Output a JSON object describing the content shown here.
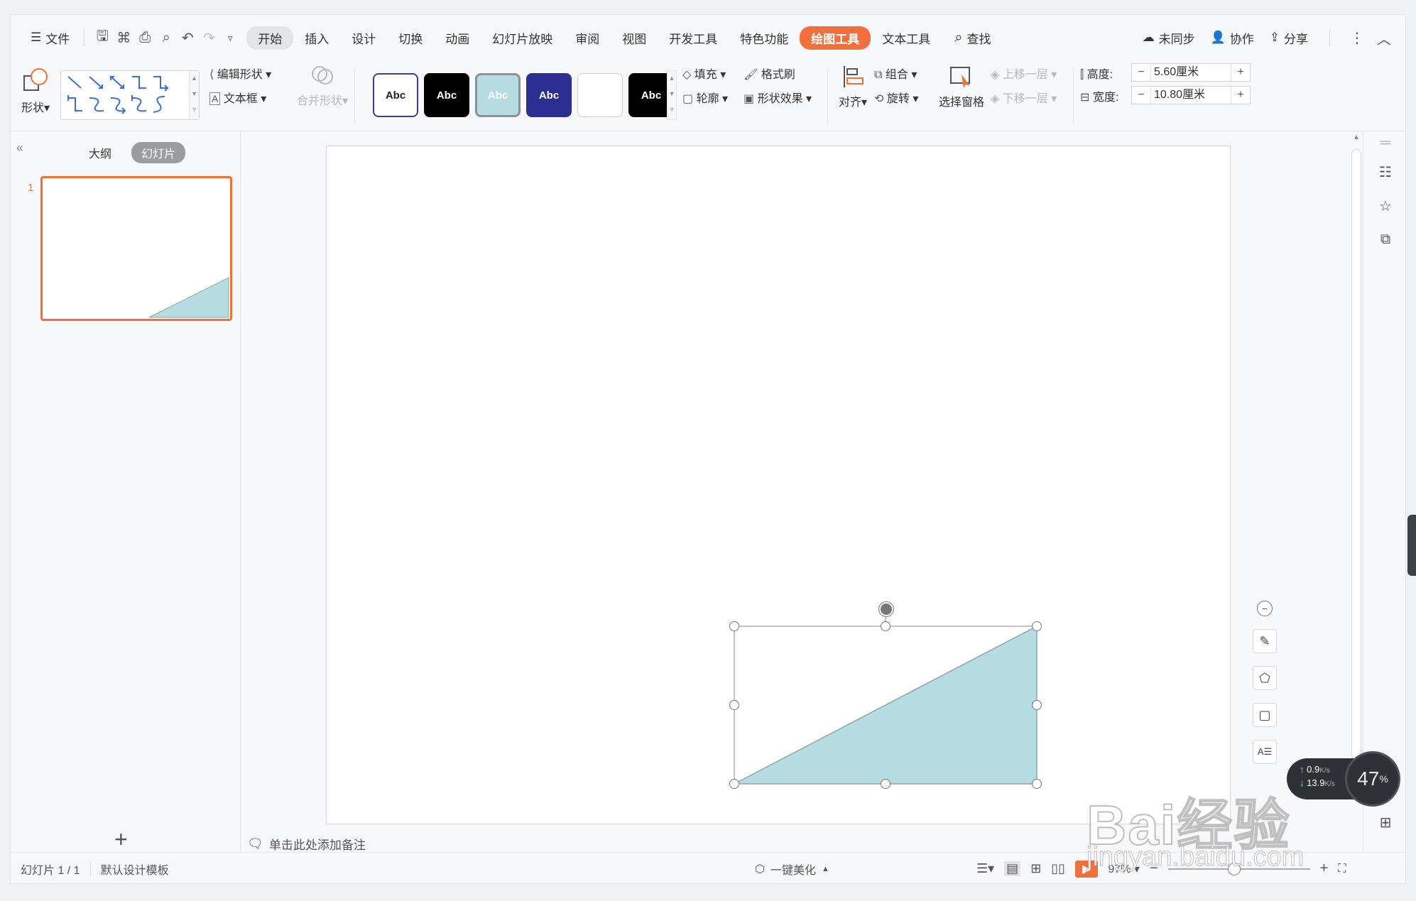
{
  "menubar": {
    "file_label": "文件",
    "tabs": [
      {
        "label": "开始",
        "state": "selected"
      },
      {
        "label": "插入"
      },
      {
        "label": "设计"
      },
      {
        "label": "切换"
      },
      {
        "label": "动画"
      },
      {
        "label": "幻灯片放映"
      },
      {
        "label": "审阅"
      },
      {
        "label": "视图"
      },
      {
        "label": "开发工具"
      },
      {
        "label": "特色功能"
      },
      {
        "label": "绘图工具",
        "state": "active"
      },
      {
        "label": "文本工具"
      }
    ],
    "search_label": "查找",
    "sync_label": "未同步",
    "collab_label": "协作",
    "share_label": "分享"
  },
  "ribbon": {
    "shape_label": "形状",
    "edit_shape_label": "编辑形状",
    "textbox_label": "文本框",
    "merge_shape_label": "合并形状",
    "style_presets": [
      "Abc",
      "Abc",
      "Abc",
      "Abc",
      "",
      "Abc"
    ],
    "fill_label": "填充",
    "format_painter_label": "格式刷",
    "outline_label": "轮廓",
    "shape_effects_label": "形状效果",
    "align_label": "对齐",
    "group_label": "组合",
    "rotate_label": "旋转",
    "selection_pane_label": "选择窗格",
    "bring_forward_label": "上移一层",
    "send_backward_label": "下移一层",
    "height_label": "高度:",
    "height_value": "5.60厘米",
    "width_label": "宽度:",
    "width_value": "10.80厘米"
  },
  "leftpanel": {
    "outline_tab": "大纲",
    "slides_tab": "幻灯片",
    "slide_number": "1"
  },
  "canvas": {
    "notes_placeholder": "单击此处添加备注",
    "shape_fill": "#b6dde1",
    "shape_stroke": "#8fa3aa"
  },
  "statusbar": {
    "slide_counter": "幻灯片 1 / 1",
    "template_label": "默认设计模板",
    "beautify_label": "一键美化",
    "zoom_label": "97%"
  },
  "network": {
    "upload": "0.9",
    "download": "13.9",
    "rate_unit": "K/s",
    "percent": "47",
    "percent_sign": "%"
  },
  "watermark": {
    "brand": "Bai经验",
    "url": "jingyan.baidu.com"
  },
  "colors": {
    "accent": "#f06f3c",
    "panel_bg": "#f7f8fa"
  }
}
